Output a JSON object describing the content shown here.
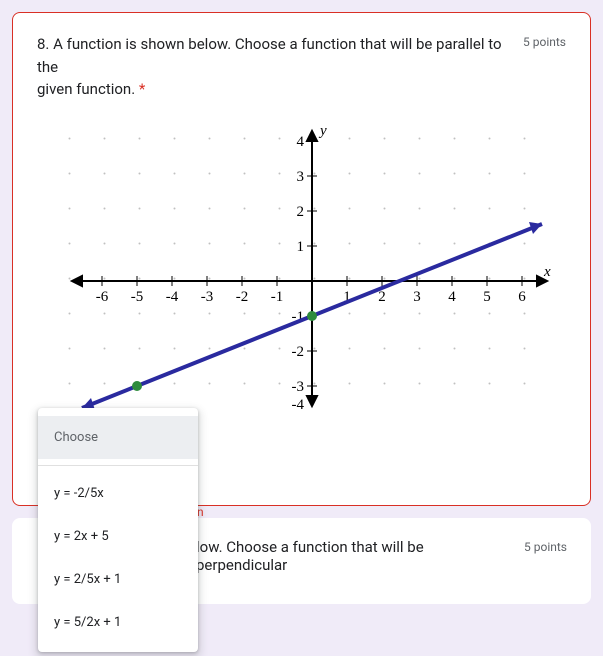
{
  "q8": {
    "text_full": "8. A function is shown below. Choose a function that will be parallel to the given function.",
    "text_line1": "8. A function is shown below. Choose a function that will be parallel to the",
    "text_line2": "given function. ",
    "required_mark": "*",
    "points": "5 points",
    "hint_fragment": "n"
  },
  "graph": {
    "x_label": "x",
    "y_label": "y",
    "x_ticks": [
      -6,
      -5,
      -4,
      -3,
      -2,
      -1,
      1,
      2,
      3,
      4,
      5,
      6
    ],
    "y_ticks_pos": [
      1,
      2,
      3,
      4
    ],
    "y_ticks_neg": [
      -1,
      -2,
      -3,
      -4
    ],
    "line_points": [
      [
        -5,
        -3
      ],
      [
        0,
        -1
      ],
      [
        5,
        1
      ]
    ],
    "marked_points": [
      [
        -5,
        -3
      ],
      [
        0,
        -1
      ]
    ]
  },
  "dropdown": {
    "placeholder": "Choose",
    "options": [
      "y = -2/5x",
      "y = 2x + 5",
      "y = 2/5x + 1",
      "y = 5/2x + 1"
    ]
  },
  "q9": {
    "visible_fragment": "low. Choose a function that will be perpendicular",
    "points": "5 points"
  }
}
